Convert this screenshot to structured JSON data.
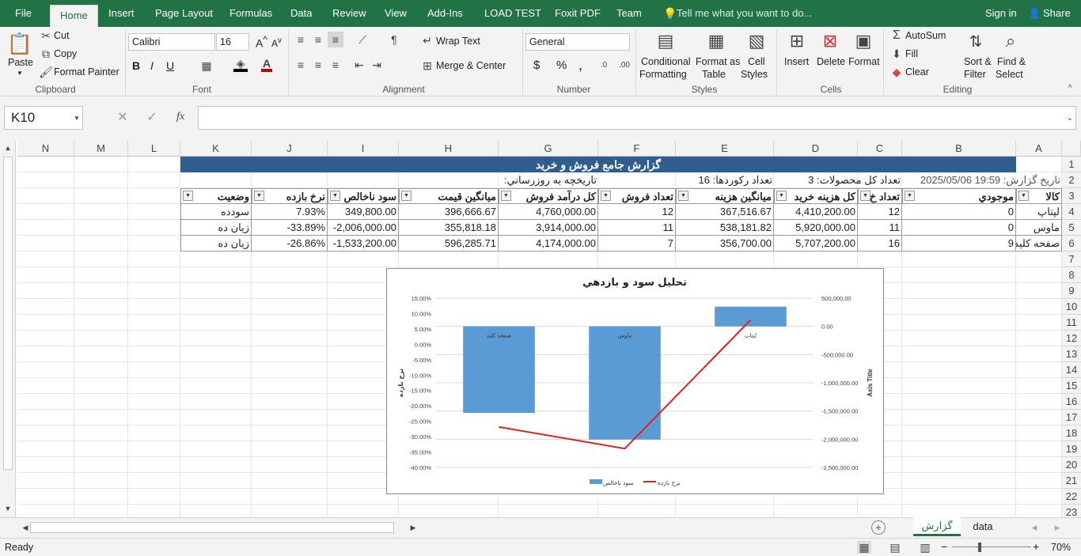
{
  "menu": {
    "file": "File",
    "tabs": [
      "Home",
      "Insert",
      "Page Layout",
      "Formulas",
      "Data",
      "Review",
      "View",
      "Add-Ins",
      "LOAD TEST",
      "Foxit PDF",
      "Team"
    ],
    "tell": "Tell me what you want to do...",
    "signin": "Sign in",
    "share": "Share"
  },
  "ribbon": {
    "paste": "Paste",
    "cut": "Cut",
    "copy": "Copy",
    "format_painter": "Format Painter",
    "clipboard": "Clipboard",
    "font_name": "Calibri",
    "font_size": "16",
    "bold": "B",
    "italic": "I",
    "underline": "U",
    "font": "Font",
    "wrap": "Wrap Text",
    "merge": "Merge & Center",
    "alignment": "Alignment",
    "number_format": "General",
    "currency": "$",
    "percent": "%",
    "comma": ",",
    "number": "Number",
    "cond": [
      "Conditional",
      "Formatting"
    ],
    "fmt_table": [
      "Format as",
      "Table"
    ],
    "cell_styles": [
      "Cell",
      "Styles"
    ],
    "styles": "Styles",
    "insert": "Insert",
    "delete": "Delete",
    "format": "Format",
    "cells": "Cells",
    "autosum": "AutoSum",
    "fill": "Fill",
    "clear": "Clear",
    "sort": [
      "Sort &",
      "Filter"
    ],
    "find": [
      "Find &",
      "Select"
    ],
    "editing": "Editing"
  },
  "formula": {
    "namebox": "K10",
    "fx": "fx",
    "value": ""
  },
  "columns": [
    "N",
    "M",
    "L",
    "K",
    "J",
    "I",
    "H",
    "G",
    "F",
    "E",
    "D",
    "C",
    "B",
    "A"
  ],
  "rows": [
    "1",
    "2",
    "3",
    "4",
    "5",
    "6",
    "7",
    "8",
    "9",
    "10",
    "11",
    "12",
    "13",
    "14",
    "15",
    "16",
    "17",
    "18",
    "19",
    "20",
    "21",
    "22",
    "23"
  ],
  "sheet": {
    "title": "گزارش جامع فروش و خريد",
    "report_date": "تاريخ گزارش: 19:59 2025/05/06",
    "total_products": "تعداد کل محصولات: 3",
    "records": "تعداد رکوردها: 16",
    "history": "تاريخچه به روزرساني:",
    "headers": {
      "A": "کالا",
      "B": "موجودي",
      "C": "تعداد خ",
      "D": "کل هزينه خريد",
      "E": "ميانگين هزينه",
      "F": "تعداد فروش",
      "G": "کل درآمد فروش",
      "H": "ميانگين قيمت",
      "I": "سود ناخالص",
      "J": "نرخ بازده",
      "K": "وضعيت"
    },
    "data": [
      {
        "A": "لپتاپ",
        "B": "0",
        "C": "12",
        "D": "4,410,200.00",
        "E": "367,516.67",
        "F": "12",
        "G": "4,760,000.00",
        "H": "396,666.67",
        "I": "349,800.00",
        "J": "7.93%",
        "K": "سودده"
      },
      {
        "A": "ماوس",
        "B": "0",
        "C": "11",
        "D": "5,920,000.00",
        "E": "538,181.82",
        "F": "11",
        "G": "3,914,000.00",
        "H": "355,818.18",
        "I": "-2,006,000.00",
        "J": "-33.89%",
        "K": "زيان ده"
      },
      {
        "A": "صفحه کليد",
        "B": "9",
        "C": "16",
        "D": "5,707,200.00",
        "E": "356,700.00",
        "F": "7",
        "G": "4,174,000.00",
        "H": "596,285.71",
        "I": "-1,533,200.00",
        "J": "-26.86%",
        "K": "زيان ده"
      }
    ]
  },
  "chart_data": {
    "type": "bar",
    "title": "تحليل سود و بازدهي",
    "categories": [
      "صفحه کليد",
      "ماوس",
      "لپتاپ"
    ],
    "series": [
      {
        "name": "سود ناخالص",
        "kind": "bar",
        "axis": "right",
        "values": [
          -1533200,
          -2006000,
          349800
        ],
        "color": "#5b9bd5"
      },
      {
        "name": "نرخ بازده",
        "kind": "line",
        "axis": "left",
        "values": [
          -26.86,
          -33.89,
          7.93
        ],
        "color": "#e0201b"
      }
    ],
    "ylabel": "نرخ بازده",
    "y2label": "Axis Title",
    "ylim": [
      -40,
      15
    ],
    "y2lim": [
      -2500000,
      500000
    ],
    "yticks": [
      "15.00%",
      "10.00%",
      "5.00%",
      "0.00%",
      "-5.00%",
      "-10.00%",
      "-15.00%",
      "-20.00%",
      "-25.00%",
      "-30.00%",
      "-35.00%",
      "-40.00%"
    ],
    "y2ticks": [
      "500,000.00",
      "0.00",
      "-500,000.00",
      "-1,000,000.00",
      "-1,500,000.00",
      "-2,000,000.00",
      "-2,500,000.00"
    ],
    "legend": "bottom",
    "grid": true
  },
  "sheets": {
    "active": "گزارش",
    "other": "data"
  },
  "status": {
    "ready": "Ready",
    "zoom": "70%"
  }
}
